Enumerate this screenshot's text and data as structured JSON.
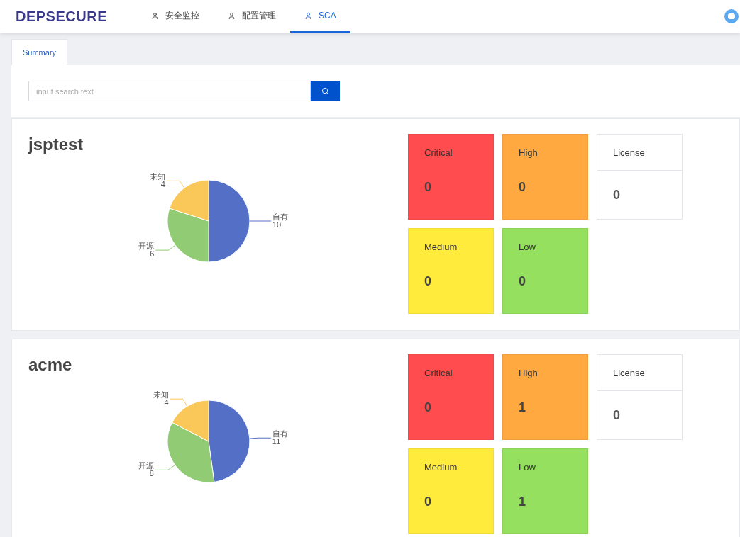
{
  "header": {
    "logo": "DEPSECURE",
    "nav": [
      {
        "label": "安全监控",
        "selected": false
      },
      {
        "label": "配置管理",
        "selected": false
      },
      {
        "label": "SCA",
        "selected": true
      }
    ]
  },
  "tabs": [
    {
      "label": "Summary",
      "selected": true
    }
  ],
  "search": {
    "placeholder": "input search text"
  },
  "projects": [
    {
      "name": "jsptest",
      "chart_data": {
        "type": "pie",
        "categories": [
          "自有",
          "开源",
          "未知"
        ],
        "values": [
          10,
          6,
          4
        ],
        "data_labels": true
      },
      "tiles": [
        {
          "kind": "severity",
          "label": "Critical",
          "count": "0",
          "color": "#ff4d4f"
        },
        {
          "kind": "severity",
          "label": "High",
          "count": "0",
          "color": "#ffa940"
        },
        {
          "kind": "license",
          "label": "License",
          "count": "0"
        },
        {
          "kind": "severity",
          "label": "Medium",
          "count": "0",
          "color": "#ffeb3b"
        },
        {
          "kind": "severity",
          "label": "Low",
          "count": "0",
          "color": "#95e05f"
        }
      ]
    },
    {
      "name": "acme",
      "chart_data": {
        "type": "pie",
        "categories": [
          "自有",
          "开源",
          "未知"
        ],
        "values": [
          11,
          8,
          4
        ],
        "data_labels": true
      },
      "tiles": [
        {
          "kind": "severity",
          "label": "Critical",
          "count": "0",
          "color": "#ff4d4f"
        },
        {
          "kind": "severity",
          "label": "High",
          "count": "1",
          "color": "#ffa940"
        },
        {
          "kind": "license",
          "label": "License",
          "count": "0"
        },
        {
          "kind": "severity",
          "label": "Medium",
          "count": "0",
          "color": "#ffeb3b"
        },
        {
          "kind": "severity",
          "label": "Low",
          "count": "1",
          "color": "#95e05f"
        }
      ]
    }
  ]
}
